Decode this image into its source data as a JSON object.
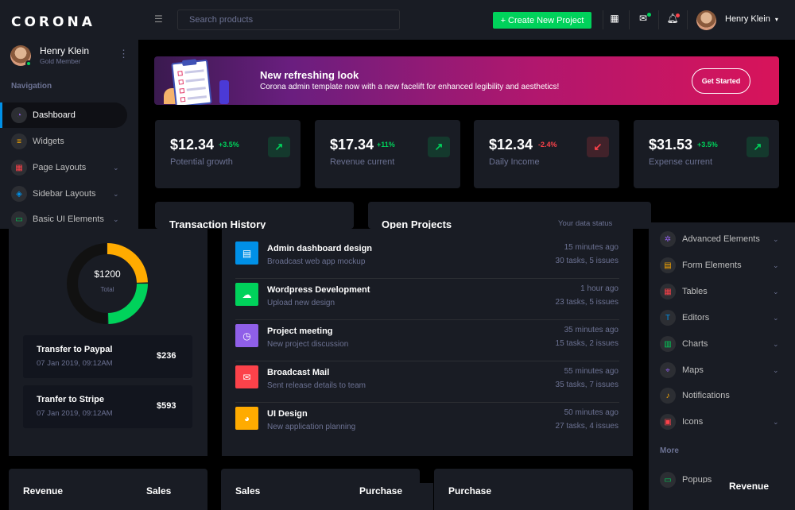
{
  "brand": "CORONA",
  "profile": {
    "name": "Henry Klein",
    "role": "Gold Member"
  },
  "sidebar": {
    "heading": "Navigation",
    "items": [
      {
        "label": "Dashboard",
        "icon": "speedometer-icon",
        "color": "#8f5fe8"
      },
      {
        "label": "Widgets",
        "icon": "playlist-icon",
        "color": "#ffab00"
      },
      {
        "label": "Page Layouts",
        "icon": "table-icon",
        "color": "#fc424a"
      },
      {
        "label": "Sidebar Layouts",
        "icon": "sidebar-icon",
        "color": "#0090e7"
      },
      {
        "label": "Basic UI Elements",
        "icon": "laptop-icon",
        "color": "#00d25b"
      }
    ],
    "more_items": [
      {
        "label": "Advanced Elements",
        "icon": "settings-icon",
        "color": "#8f5fe8"
      },
      {
        "label": "Form Elements",
        "icon": "form-icon",
        "color": "#ffab00"
      },
      {
        "label": "Tables",
        "icon": "table-icon",
        "color": "#fc424a"
      },
      {
        "label": "Editors",
        "icon": "format-text-icon",
        "color": "#0090e7"
      },
      {
        "label": "Charts",
        "icon": "chart-icon",
        "color": "#00d25b"
      },
      {
        "label": "Maps",
        "icon": "map-marker-icon",
        "color": "#8f5fe8"
      },
      {
        "label": "Notifications",
        "icon": "bell-icon",
        "color": "#ffab00"
      },
      {
        "label": "Icons",
        "icon": "contacts-icon",
        "color": "#fc424a"
      }
    ],
    "more_heading": "More",
    "popups": "Popups"
  },
  "navbar": {
    "search_placeholder": "Search products",
    "create_label": "+ Create New Project",
    "user": "Henry Klein"
  },
  "banner": {
    "title": "New refreshing look",
    "subtitle": "Corona admin template now with a new facelift for enhanced legibility and aesthetics!",
    "button": "Get Started"
  },
  "stats": [
    {
      "value": "$12.34",
      "change": "+3.5%",
      "label": "Potential growth",
      "direction": "up"
    },
    {
      "value": "$17.34",
      "change": "+11%",
      "label": "Revenue current",
      "direction": "up"
    },
    {
      "value": "$12.34",
      "change": "-2.4%",
      "label": "Daily Income",
      "direction": "down"
    },
    {
      "value": "$31.53",
      "change": "+3.5%",
      "label": "Expense current",
      "direction": "up"
    }
  ],
  "transactions": {
    "title": "Transaction History",
    "total": "$1200",
    "total_label": "Total",
    "donut_segments": [
      {
        "value": 25,
        "color": "#ffab00"
      },
      {
        "value": 25,
        "color": "#00d25b"
      },
      {
        "value": 50,
        "color": "#111111"
      }
    ],
    "items": [
      {
        "name": "Transfer to Paypal",
        "date": "07 Jan 2019, 09:12AM",
        "amount": "$236"
      },
      {
        "name": "Tranfer to Stripe",
        "date": "07 Jan 2019, 09:12AM",
        "amount": "$593"
      }
    ]
  },
  "projects": {
    "title": "Open Projects",
    "status": "Your data status",
    "items": [
      {
        "title": "Admin dashboard design",
        "sub": "Broadcast web app mockup",
        "time": "15 minutes ago",
        "meta": "30 tasks, 5 issues",
        "color": "#0090e7",
        "icon": "file-icon"
      },
      {
        "title": "Wordpress Development",
        "sub": "Upload new design",
        "time": "1 hour ago",
        "meta": "23 tasks, 5 issues",
        "color": "#00d25b",
        "icon": "cloud-download-icon"
      },
      {
        "title": "Project meeting",
        "sub": "New project discussion",
        "time": "35 minutes ago",
        "meta": "15 tasks, 2 issues",
        "color": "#8f5fe8",
        "icon": "clock-icon"
      },
      {
        "title": "Broadcast Mail",
        "sub": "Sent release details to team",
        "time": "55 minutes ago",
        "meta": "35 tasks, 7 issues",
        "color": "#fc424a",
        "icon": "email-open-icon"
      },
      {
        "title": "UI Design",
        "sub": "New application planning",
        "time": "50 minutes ago",
        "meta": "27 tasks, 4 issues",
        "color": "#ffab00",
        "icon": "chart-pie-icon"
      }
    ]
  },
  "bottom": {
    "revenue_left": "Revenue",
    "sales": "Sales",
    "sales2": "Sales",
    "purchase": "Purchase",
    "purchase2": "Purchase",
    "revenue_right": "Revenue"
  }
}
